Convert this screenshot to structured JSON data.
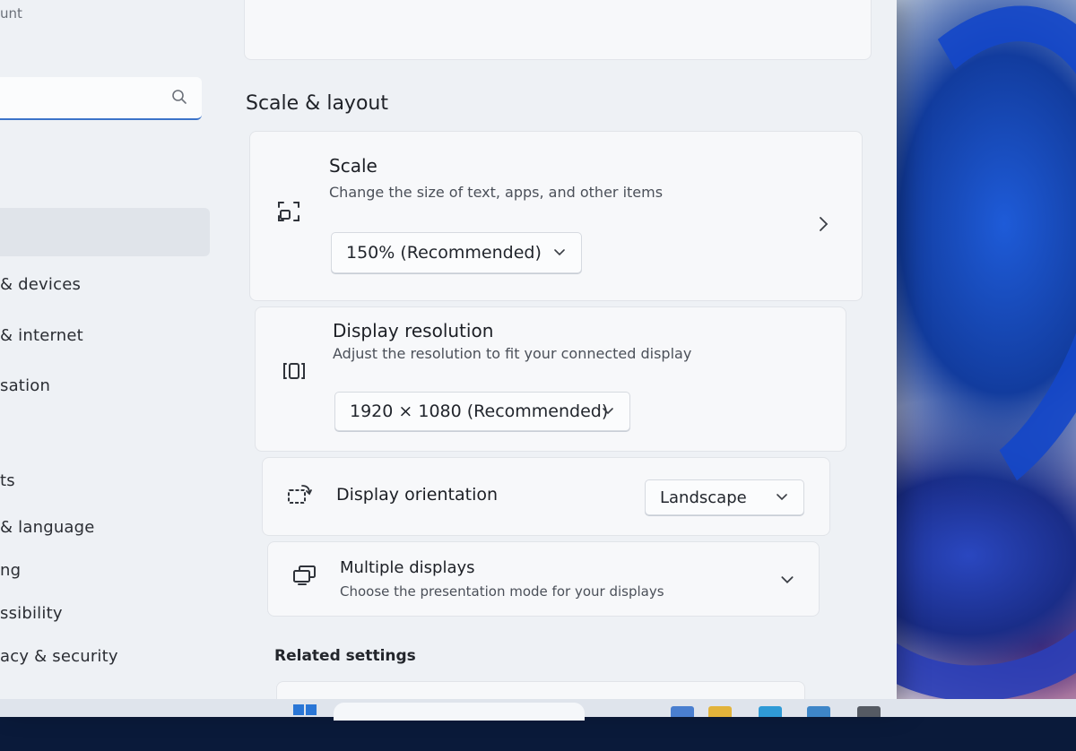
{
  "sidebar": {
    "account_fragment": "unt",
    "search_placeholder": "",
    "items": [
      {
        "label": "& devices"
      },
      {
        "label": "& internet"
      },
      {
        "label": "sation"
      },
      {
        "label": "ts"
      },
      {
        "label": "& language"
      },
      {
        "label": "ng"
      },
      {
        "label": "ssibility"
      },
      {
        "label": "acy & security"
      }
    ]
  },
  "main": {
    "section_title": "Scale & layout",
    "scale": {
      "title": "Scale",
      "description": "Change the size of text, apps, and other items",
      "value": "150% (Recommended)"
    },
    "resolution": {
      "title": "Display resolution",
      "description": "Adjust the resolution to fit your connected display",
      "value": "1920 × 1080 (Recommended)"
    },
    "orientation": {
      "title": "Display orientation",
      "value": "Landscape"
    },
    "multiple": {
      "title": "Multiple displays",
      "description": "Choose the presentation mode for your displays"
    },
    "related_title": "Related settings"
  },
  "colors": {
    "accent": "#3b73c9",
    "window_bg": "#eef1f5",
    "card_bg": "#f7f8fa"
  },
  "icons": {
    "scale": "scale-icon",
    "resolution": "resolution-icon",
    "orientation": "orientation-icon",
    "multiple": "multiple-displays-icon"
  }
}
